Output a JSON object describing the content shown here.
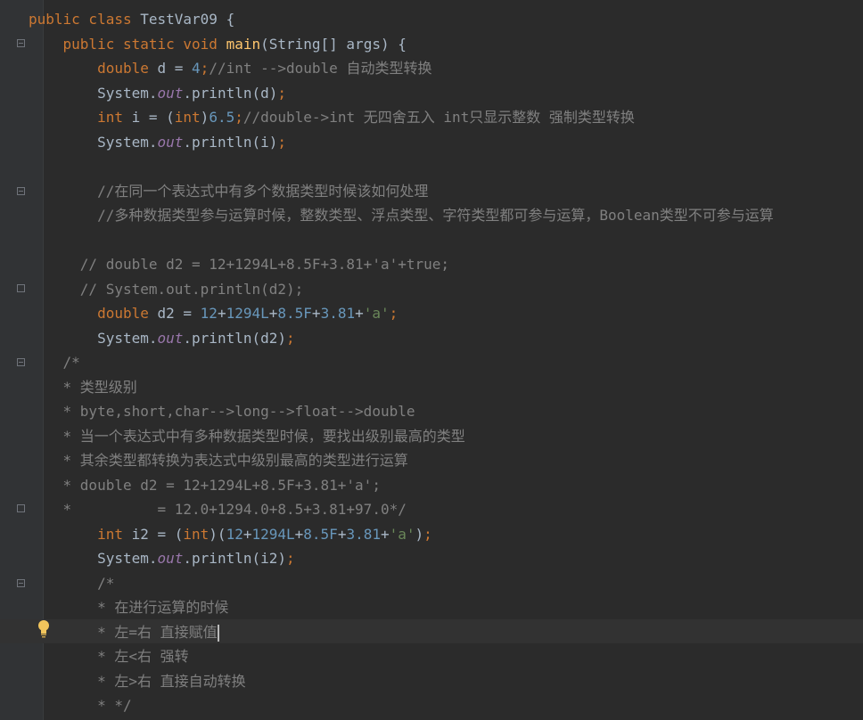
{
  "editor": {
    "language": "Java",
    "theme": "Darcula",
    "lines": [
      [
        {
          "t": "kw",
          "v": "public class "
        },
        {
          "t": "plain",
          "v": "TestVar09 {"
        }
      ],
      [
        {
          "t": "plain",
          "v": "    "
        },
        {
          "t": "kw",
          "v": "public static void "
        },
        {
          "t": "fn",
          "v": "main"
        },
        {
          "t": "plain",
          "v": "(String[] args) {"
        }
      ],
      [
        {
          "t": "plain",
          "v": "        "
        },
        {
          "t": "kw",
          "v": "double "
        },
        {
          "t": "plain",
          "v": "d = "
        },
        {
          "t": "num",
          "v": "4"
        },
        {
          "t": "kw",
          "v": ";"
        },
        {
          "t": "com",
          "v": "//int -->double 自动类型转换"
        }
      ],
      [
        {
          "t": "plain",
          "v": "        System."
        },
        {
          "t": "fld",
          "v": "out"
        },
        {
          "t": "plain",
          "v": ".println(d)"
        },
        {
          "t": "kw",
          "v": ";"
        }
      ],
      [
        {
          "t": "plain",
          "v": "        "
        },
        {
          "t": "kw",
          "v": "int "
        },
        {
          "t": "plain",
          "v": "i = ("
        },
        {
          "t": "kw",
          "v": "int"
        },
        {
          "t": "plain",
          "v": ")"
        },
        {
          "t": "num",
          "v": "6.5"
        },
        {
          "t": "kw",
          "v": ";"
        },
        {
          "t": "com",
          "v": "//double->int 无四舍五入 int只显示整数 强制类型转换"
        }
      ],
      [
        {
          "t": "plain",
          "v": "        System."
        },
        {
          "t": "fld",
          "v": "out"
        },
        {
          "t": "plain",
          "v": ".println(i)"
        },
        {
          "t": "kw",
          "v": ";"
        }
      ],
      [],
      [
        {
          "t": "plain",
          "v": "        "
        },
        {
          "t": "com",
          "v": "//在同一个表达式中有多个数据类型时候该如何处理"
        }
      ],
      [
        {
          "t": "plain",
          "v": "        "
        },
        {
          "t": "com",
          "v": "//多种数据类型参与运算时候，整数类型、浮点类型、字符类型都可参与运算，Boolean类型不可参与运算"
        }
      ],
      [],
      [
        {
          "t": "plain",
          "v": "      "
        },
        {
          "t": "com",
          "v": "// double d2 = 12+1294L+8.5F+3.81+'a'+true;"
        }
      ],
      [
        {
          "t": "plain",
          "v": "      "
        },
        {
          "t": "com",
          "v": "// System.out.println(d2);"
        }
      ],
      [
        {
          "t": "plain",
          "v": "        "
        },
        {
          "t": "kw",
          "v": "double "
        },
        {
          "t": "plain",
          "v": "d2 = "
        },
        {
          "t": "num",
          "v": "12"
        },
        {
          "t": "plain",
          "v": "+"
        },
        {
          "t": "num",
          "v": "1294L"
        },
        {
          "t": "plain",
          "v": "+"
        },
        {
          "t": "num",
          "v": "8.5F"
        },
        {
          "t": "plain",
          "v": "+"
        },
        {
          "t": "num",
          "v": "3.81"
        },
        {
          "t": "plain",
          "v": "+"
        },
        {
          "t": "str",
          "v": "'a'"
        },
        {
          "t": "kw",
          "v": ";"
        }
      ],
      [
        {
          "t": "plain",
          "v": "        System."
        },
        {
          "t": "fld",
          "v": "out"
        },
        {
          "t": "plain",
          "v": ".println(d2)"
        },
        {
          "t": "kw",
          "v": ";"
        }
      ],
      [
        {
          "t": "plain",
          "v": "    "
        },
        {
          "t": "com",
          "v": "/*"
        }
      ],
      [
        {
          "t": "plain",
          "v": "    "
        },
        {
          "t": "com",
          "v": "* 类型级别"
        }
      ],
      [
        {
          "t": "plain",
          "v": "    "
        },
        {
          "t": "com",
          "v": "* byte,short,char-->long-->float-->double"
        }
      ],
      [
        {
          "t": "plain",
          "v": "    "
        },
        {
          "t": "com",
          "v": "* 当一个表达式中有多种数据类型时候，要找出级别最高的类型"
        }
      ],
      [
        {
          "t": "plain",
          "v": "    "
        },
        {
          "t": "com",
          "v": "* 其余类型都转换为表达式中级别最高的类型进行运算"
        }
      ],
      [
        {
          "t": "plain",
          "v": "    "
        },
        {
          "t": "com",
          "v": "* double d2 = 12+1294L+8.5F+3.81+'a';"
        }
      ],
      [
        {
          "t": "plain",
          "v": "    "
        },
        {
          "t": "com",
          "v": "*          = 12.0+1294.0+8.5+3.81+97.0*/"
        }
      ],
      [
        {
          "t": "plain",
          "v": "        "
        },
        {
          "t": "kw",
          "v": "int "
        },
        {
          "t": "plain",
          "v": "i2 = ("
        },
        {
          "t": "kw",
          "v": "int"
        },
        {
          "t": "plain",
          "v": ")("
        },
        {
          "t": "num",
          "v": "12"
        },
        {
          "t": "plain",
          "v": "+"
        },
        {
          "t": "num",
          "v": "1294L"
        },
        {
          "t": "plain",
          "v": "+"
        },
        {
          "t": "num",
          "v": "8.5F"
        },
        {
          "t": "plain",
          "v": "+"
        },
        {
          "t": "num",
          "v": "3.81"
        },
        {
          "t": "plain",
          "v": "+"
        },
        {
          "t": "str",
          "v": "'a'"
        },
        {
          "t": "plain",
          "v": ")"
        },
        {
          "t": "kw",
          "v": ";"
        }
      ],
      [
        {
          "t": "plain",
          "v": "        System."
        },
        {
          "t": "fld",
          "v": "out"
        },
        {
          "t": "plain",
          "v": ".println(i2)"
        },
        {
          "t": "kw",
          "v": ";"
        }
      ],
      [
        {
          "t": "plain",
          "v": "        "
        },
        {
          "t": "com",
          "v": "/*"
        }
      ],
      [
        {
          "t": "plain",
          "v": "        "
        },
        {
          "t": "com",
          "v": "* 在进行运算的时候"
        }
      ],
      [
        {
          "t": "plain",
          "v": "        "
        },
        {
          "t": "com",
          "v": "* 左=右 直接赋值"
        }
      ],
      [
        {
          "t": "plain",
          "v": "        "
        },
        {
          "t": "com",
          "v": "* 左<右 强转"
        }
      ],
      [
        {
          "t": "plain",
          "v": "        "
        },
        {
          "t": "com",
          "v": "* 左>右 直接自动转换"
        }
      ],
      [
        {
          "t": "plain",
          "v": "        "
        },
        {
          "t": "com",
          "v": "* */"
        }
      ]
    ]
  }
}
